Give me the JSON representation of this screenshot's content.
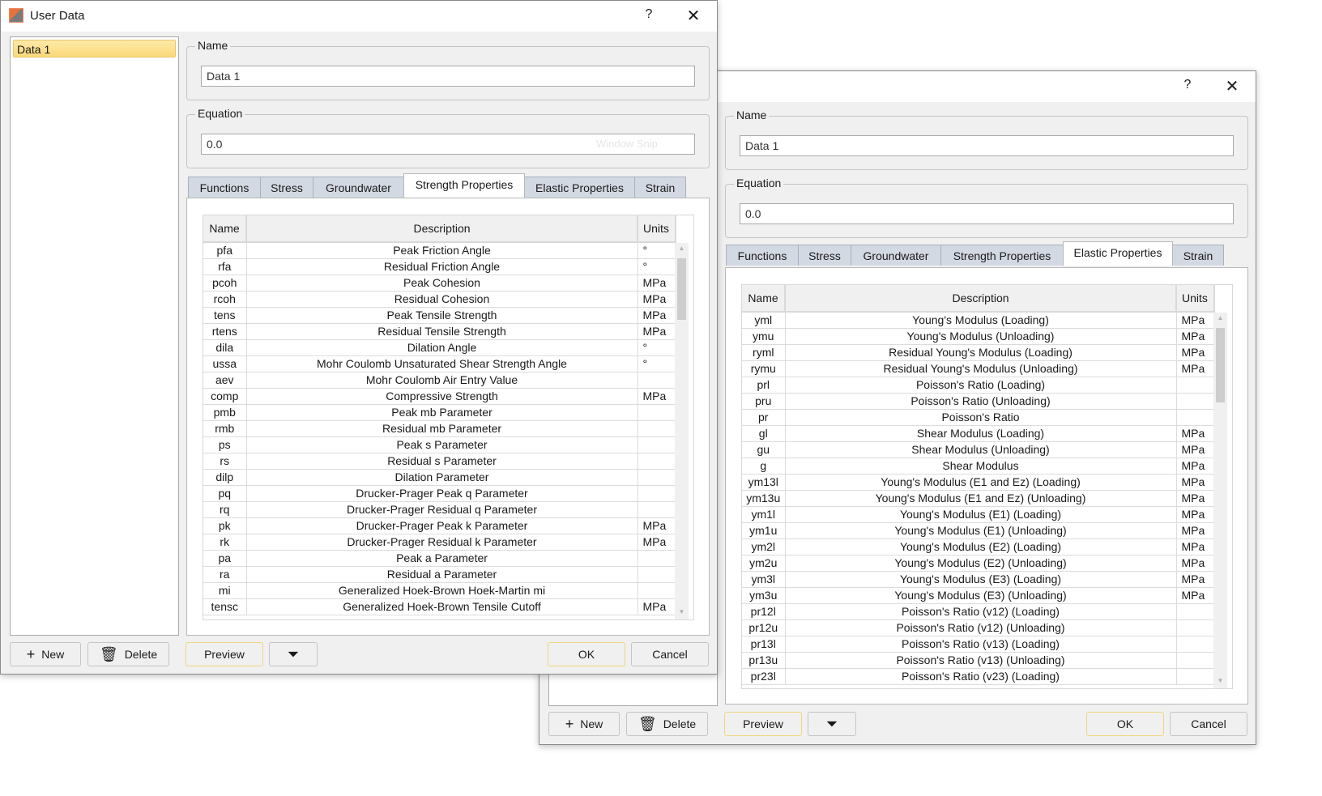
{
  "dialog_front": {
    "title": "User Data",
    "help_label": "?",
    "close_label": "✕",
    "list": {
      "items": [
        {
          "label": "Data 1",
          "selected": true
        }
      ]
    },
    "name_group": {
      "label": "Name",
      "value": "Data 1"
    },
    "equation_group": {
      "label": "Equation",
      "value": "0.0",
      "overlay_text": "Window Snip"
    },
    "tabs": [
      {
        "label": "Functions",
        "active": false
      },
      {
        "label": "Stress",
        "active": false
      },
      {
        "label": "Groundwater",
        "active": false
      },
      {
        "label": "Strength Properties",
        "active": true
      },
      {
        "label": "Elastic Properties",
        "active": false
      },
      {
        "label": "Strain",
        "active": false
      }
    ],
    "table": {
      "columns": [
        "Name",
        "Description",
        "Units"
      ],
      "rows": [
        [
          "pfa",
          "Peak Friction Angle",
          "°"
        ],
        [
          "rfa",
          "Residual Friction Angle",
          "°"
        ],
        [
          "pcoh",
          "Peak Cohesion",
          "MPa"
        ],
        [
          "rcoh",
          "Residual Cohesion",
          "MPa"
        ],
        [
          "tens",
          "Peak Tensile Strength",
          "MPa"
        ],
        [
          "rtens",
          "Residual Tensile Strength",
          "MPa"
        ],
        [
          "dila",
          "Dilation Angle",
          "°"
        ],
        [
          "ussa",
          "Mohr Coulomb Unsaturated Shear Strength Angle",
          "°"
        ],
        [
          "aev",
          "Mohr Coulomb Air Entry Value",
          ""
        ],
        [
          "comp",
          "Compressive Strength",
          "MPa"
        ],
        [
          "pmb",
          "Peak mb Parameter",
          ""
        ],
        [
          "rmb",
          "Residual mb Parameter",
          ""
        ],
        [
          "ps",
          "Peak s Parameter",
          ""
        ],
        [
          "rs",
          "Residual s Parameter",
          ""
        ],
        [
          "dilp",
          "Dilation Parameter",
          ""
        ],
        [
          "pq",
          "Drucker-Prager Peak q Parameter",
          ""
        ],
        [
          "rq",
          "Drucker-Prager Residual q Parameter",
          ""
        ],
        [
          "pk",
          "Drucker-Prager Peak k Parameter",
          "MPa"
        ],
        [
          "rk",
          "Drucker-Prager Residual k Parameter",
          "MPa"
        ],
        [
          "pa",
          "Peak a Parameter",
          ""
        ],
        [
          "ra",
          "Residual a Parameter",
          ""
        ],
        [
          "mi",
          "Generalized Hoek-Brown Hoek-Martin mi",
          ""
        ],
        [
          "tensc",
          "Generalized Hoek-Brown Tensile Cutoff",
          "MPa"
        ]
      ]
    },
    "buttons": {
      "new": "New",
      "delete": "Delete",
      "preview": "Preview",
      "filter_icon": "filter-icon",
      "ok": "OK",
      "cancel": "Cancel"
    }
  },
  "dialog_back": {
    "help_label": "?",
    "close_label": "✕",
    "name_group": {
      "label": "Name",
      "value": "Data 1"
    },
    "equation_group": {
      "label": "Equation",
      "value": "0.0"
    },
    "tabs": [
      {
        "label": "Functions",
        "active": false
      },
      {
        "label": "Stress",
        "active": false
      },
      {
        "label": "Groundwater",
        "active": false
      },
      {
        "label": "Strength Properties",
        "active": false
      },
      {
        "label": "Elastic Properties",
        "active": true
      },
      {
        "label": "Strain",
        "active": false
      }
    ],
    "table": {
      "columns": [
        "Name",
        "Description",
        "Units"
      ],
      "rows": [
        [
          "yml",
          "Young's Modulus (Loading)",
          "MPa"
        ],
        [
          "ymu",
          "Young's Modulus (Unloading)",
          "MPa"
        ],
        [
          "ryml",
          "Residual Young's Modulus (Loading)",
          "MPa"
        ],
        [
          "rymu",
          "Residual Young's Modulus (Unloading)",
          "MPa"
        ],
        [
          "prl",
          "Poisson's Ratio (Loading)",
          ""
        ],
        [
          "pru",
          "Poisson's Ratio (Unloading)",
          ""
        ],
        [
          "pr",
          "Poisson's Ratio",
          ""
        ],
        [
          "gl",
          "Shear Modulus (Loading)",
          "MPa"
        ],
        [
          "gu",
          "Shear Modulus (Unloading)",
          "MPa"
        ],
        [
          "g",
          "Shear Modulus",
          "MPa"
        ],
        [
          "ym13l",
          "Young's Modulus (E1 and Ez) (Loading)",
          "MPa"
        ],
        [
          "ym13u",
          "Young's Modulus (E1 and Ez) (Unloading)",
          "MPa"
        ],
        [
          "ym1l",
          "Young's Modulus (E1) (Loading)",
          "MPa"
        ],
        [
          "ym1u",
          "Young's Modulus (E1) (Unloading)",
          "MPa"
        ],
        [
          "ym2l",
          "Young's Modulus (E2) (Loading)",
          "MPa"
        ],
        [
          "ym2u",
          "Young's Modulus (E2) (Unloading)",
          "MPa"
        ],
        [
          "ym3l",
          "Young's Modulus (E3) (Loading)",
          "MPa"
        ],
        [
          "ym3u",
          "Young's Modulus (E3) (Unloading)",
          "MPa"
        ],
        [
          "pr12l",
          "Poisson's Ratio (v12) (Loading)",
          ""
        ],
        [
          "pr12u",
          "Poisson's Ratio (v12) (Unloading)",
          ""
        ],
        [
          "pr13l",
          "Poisson's Ratio (v13) (Loading)",
          ""
        ],
        [
          "pr13u",
          "Poisson's Ratio (v13) (Unloading)",
          ""
        ],
        [
          "pr23l",
          "Poisson's Ratio (v23) (Loading)",
          ""
        ]
      ]
    },
    "buttons": {
      "new": "New",
      "delete": "Delete",
      "preview": "Preview",
      "filter_icon": "filter-icon",
      "ok": "OK",
      "cancel": "Cancel"
    }
  }
}
